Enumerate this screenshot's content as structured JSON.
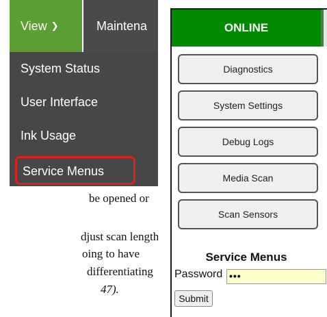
{
  "navbar": {
    "view_label": "View",
    "view_chevron": "✔",
    "maintenance_label": "Maintena"
  },
  "view_menu": {
    "items": [
      {
        "label": "System Status"
      },
      {
        "label": "User Interface"
      },
      {
        "label": "Ink Usage"
      },
      {
        "label": "Service Menus"
      }
    ],
    "highlight_color": "#e0201b"
  },
  "document_text": {
    "lines": [
      "be opened or",
      "djust scan length if",
      "oing to have",
      "differentiating",
      "47)."
    ]
  },
  "service_panel": {
    "status_tab": "ONLINE",
    "status_color": "#008a00",
    "buttons": [
      {
        "label": "Diagnostics"
      },
      {
        "label": "System Settings"
      },
      {
        "label": "Debug Logs"
      },
      {
        "label": "Media Scan"
      },
      {
        "label": "Scan Sensors"
      }
    ],
    "section_title": "Service Menus",
    "password_label": "Password",
    "password_value": "•••",
    "submit_label": "Submit"
  }
}
